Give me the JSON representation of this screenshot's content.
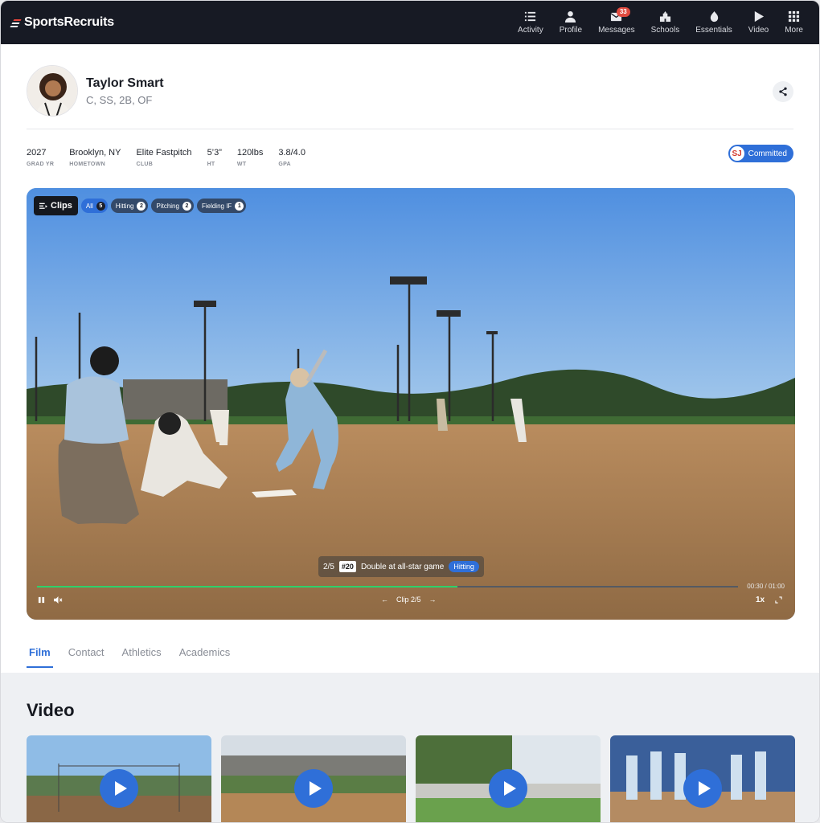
{
  "brand": {
    "logo_text": "SportsRecruits"
  },
  "nav": {
    "items": [
      {
        "label": "Activity",
        "icon": "activity-icon"
      },
      {
        "label": "Profile",
        "icon": "profile-icon"
      },
      {
        "label": "Messages",
        "icon": "messages-icon",
        "badge": "33"
      },
      {
        "label": "Schools",
        "icon": "schools-icon"
      },
      {
        "label": "Essentials",
        "icon": "essentials-icon"
      },
      {
        "label": "Video",
        "icon": "video-icon"
      },
      {
        "label": "More",
        "icon": "more-grid-icon"
      }
    ]
  },
  "profile": {
    "name": "Taylor Smart",
    "positions": "C, SS, 2B, OF",
    "stats": [
      {
        "value": "2027",
        "label": "GRAD YR"
      },
      {
        "value": "Brooklyn, NY",
        "label": "HOMETOWN"
      },
      {
        "value": "Elite Fastpitch",
        "label": "CLUB"
      },
      {
        "value": "5’3”",
        "label": "HT"
      },
      {
        "value": "120lbs",
        "label": "WT"
      },
      {
        "value": "3.8/4.0",
        "label": "GPA"
      }
    ],
    "committed_label": "Committed",
    "committed_logo": "SJ"
  },
  "player": {
    "clips_label": "Clips",
    "filters": [
      {
        "label": "All",
        "count": "5",
        "active": true
      },
      {
        "label": "Hitting",
        "count": "2"
      },
      {
        "label": "Pitching",
        "count": "2"
      },
      {
        "label": "Fielding IF",
        "count": "1"
      }
    ],
    "caption": {
      "position": "2/5",
      "number": "#20",
      "title": "Double at all-star game",
      "tag": "Hitting"
    },
    "progress": 0.6,
    "time": "00:30 / 01:00",
    "clip_nav": "Clip 2/5",
    "speed": "1x"
  },
  "tabs": [
    "Film",
    "Contact",
    "Athletics",
    "Academics"
  ],
  "video_section": {
    "title": "Video"
  },
  "colors": {
    "accent": "#2f6fd8",
    "nav_bg": "#171a24",
    "progress": "#2fd06a",
    "badge": "#e04a3f"
  }
}
